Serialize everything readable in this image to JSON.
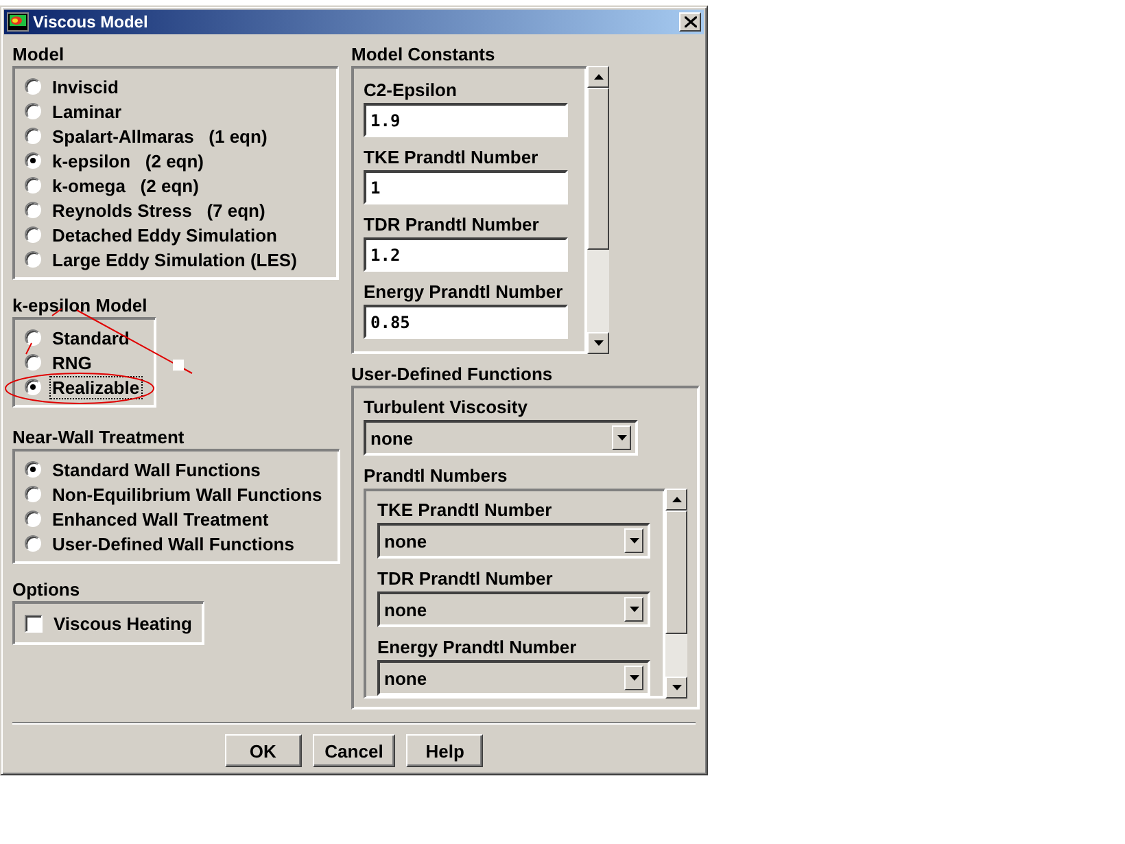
{
  "window": {
    "title": "Viscous Model"
  },
  "model": {
    "title": "Model",
    "options": [
      {
        "label": "Inviscid",
        "selected": false,
        "focused": false
      },
      {
        "label": "Laminar",
        "selected": false,
        "focused": false
      },
      {
        "label": "Spalart-Allmaras   (1 eqn)",
        "selected": false,
        "focused": false
      },
      {
        "label": "k-epsilon   (2 eqn)",
        "selected": true,
        "focused": false
      },
      {
        "label": "k-omega   (2 eqn)",
        "selected": false,
        "focused": false
      },
      {
        "label": "Reynolds Stress   (7 eqn)",
        "selected": false,
        "focused": false
      },
      {
        "label": "Detached Eddy Simulation",
        "selected": false,
        "focused": false
      },
      {
        "label": "Large Eddy Simulation (LES)",
        "selected": false,
        "focused": false
      }
    ]
  },
  "k_epsilon_model": {
    "title": "k-epsilon Model",
    "options": [
      {
        "label": "Standard",
        "selected": false,
        "focused": false
      },
      {
        "label": "RNG",
        "selected": false,
        "focused": false
      },
      {
        "label": "Realizable",
        "selected": true,
        "focused": true
      }
    ]
  },
  "near_wall_treatment": {
    "title": "Near-Wall Treatment",
    "options": [
      {
        "label": "Standard Wall Functions",
        "selected": true,
        "focused": false
      },
      {
        "label": "Non-Equilibrium Wall Functions",
        "selected": false,
        "focused": false
      },
      {
        "label": "Enhanced Wall Treatment",
        "selected": false,
        "focused": false
      },
      {
        "label": "User-Defined Wall Functions",
        "selected": false,
        "focused": false
      }
    ]
  },
  "options": {
    "title": "Options",
    "items": [
      {
        "label": "Viscous Heating",
        "checked": false
      }
    ]
  },
  "model_constants": {
    "title": "Model Constants",
    "fields": [
      {
        "label": "C2-Epsilon",
        "value": "1.9"
      },
      {
        "label": "TKE Prandtl Number",
        "value": "1"
      },
      {
        "label": "TDR Prandtl Number",
        "value": "1.2"
      },
      {
        "label": "Energy Prandtl Number",
        "value": "0.85"
      }
    ]
  },
  "user_defined_functions": {
    "title": "User-Defined Functions",
    "turbulent_viscosity": {
      "label": "Turbulent Viscosity",
      "value": "none"
    },
    "prandtl_numbers": {
      "title": "Prandtl Numbers",
      "fields": [
        {
          "label": "TKE Prandtl Number",
          "value": "none"
        },
        {
          "label": "TDR Prandtl Number",
          "value": "none"
        },
        {
          "label": "Energy Prandtl Number",
          "value": "none"
        }
      ]
    }
  },
  "buttons": [
    "OK",
    "Cancel",
    "Help"
  ]
}
